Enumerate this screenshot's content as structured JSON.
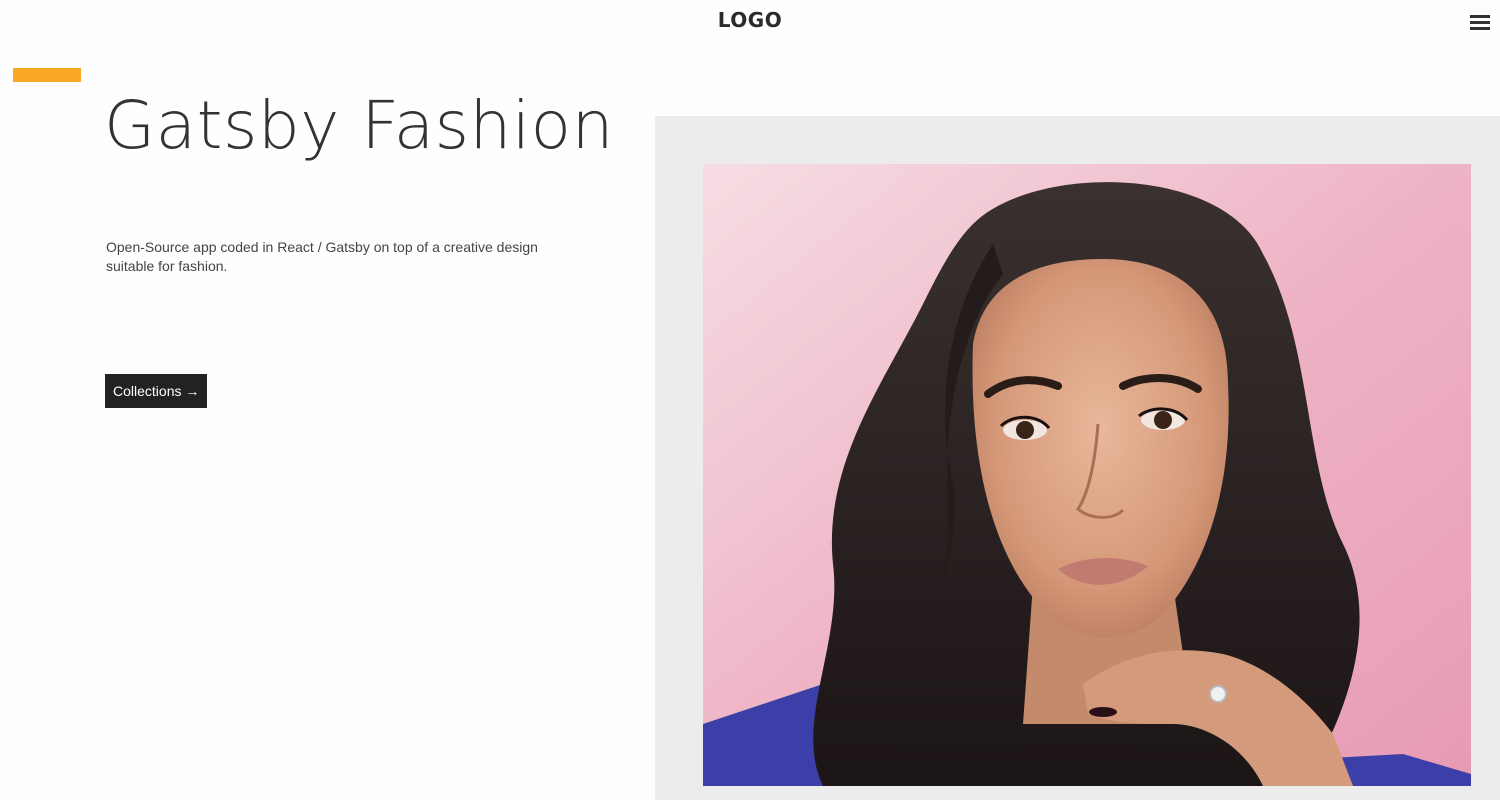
{
  "header": {
    "logo": "LOGO",
    "menu_icon": "hamburger-menu-icon"
  },
  "hero": {
    "title": "Gatsby Fashion",
    "description": "Open-Source app coded in React / Gatsby on top of a creative design suitable for fashion.",
    "cta_label": "Collections →"
  },
  "colors": {
    "accent": "#f9a825",
    "button_bg": "#222222",
    "panel_bg": "#ececec",
    "photo_bg": "#eaa6bd"
  },
  "image": {
    "subject": "portrait-photo"
  }
}
